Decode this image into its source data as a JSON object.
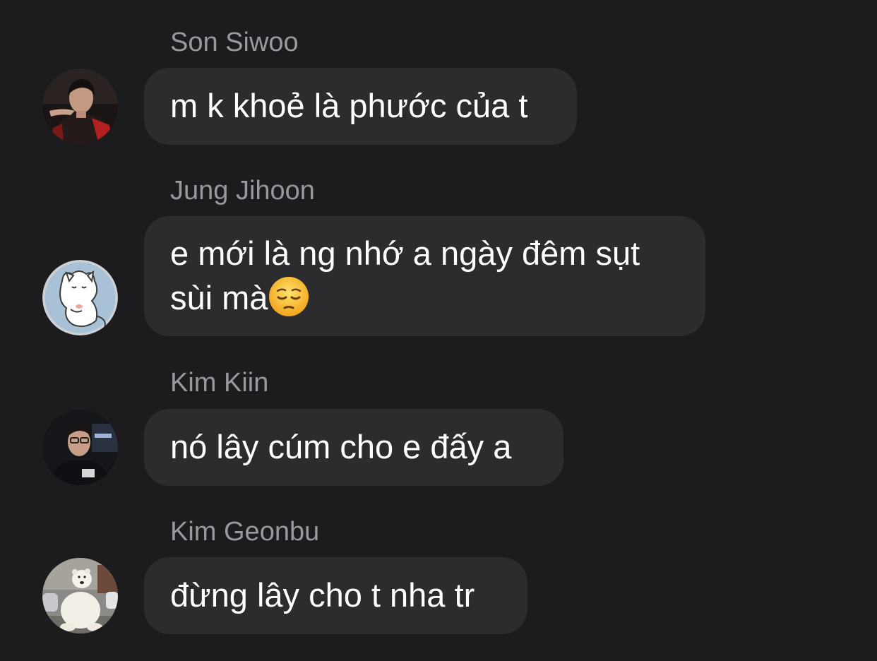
{
  "messages": [
    {
      "sender": "Son Siwoo",
      "text": "m k khoẻ là phước của t",
      "avatar": "person-photo-avatar"
    },
    {
      "sender": "Jung Jihoon",
      "text": "e mới là ng nhớ a ngày đêm sụt\nsùi mà",
      "emoji": "pensive-face-emoji",
      "avatar": "white-cat-cartoon-avatar"
    },
    {
      "sender": "Kim Kiin",
      "text": "nó lây cúm cho e đấy a",
      "avatar": "person-photo-avatar"
    },
    {
      "sender": "Kim Geonbu",
      "text": "đừng lây cho t nha tr",
      "avatar": "polar-bear-avatar"
    }
  ],
  "colors": {
    "background": "#1c1c1e",
    "bubble": "#2c2c2e",
    "sender_name": "#98989f",
    "message_text": "#ffffff"
  }
}
